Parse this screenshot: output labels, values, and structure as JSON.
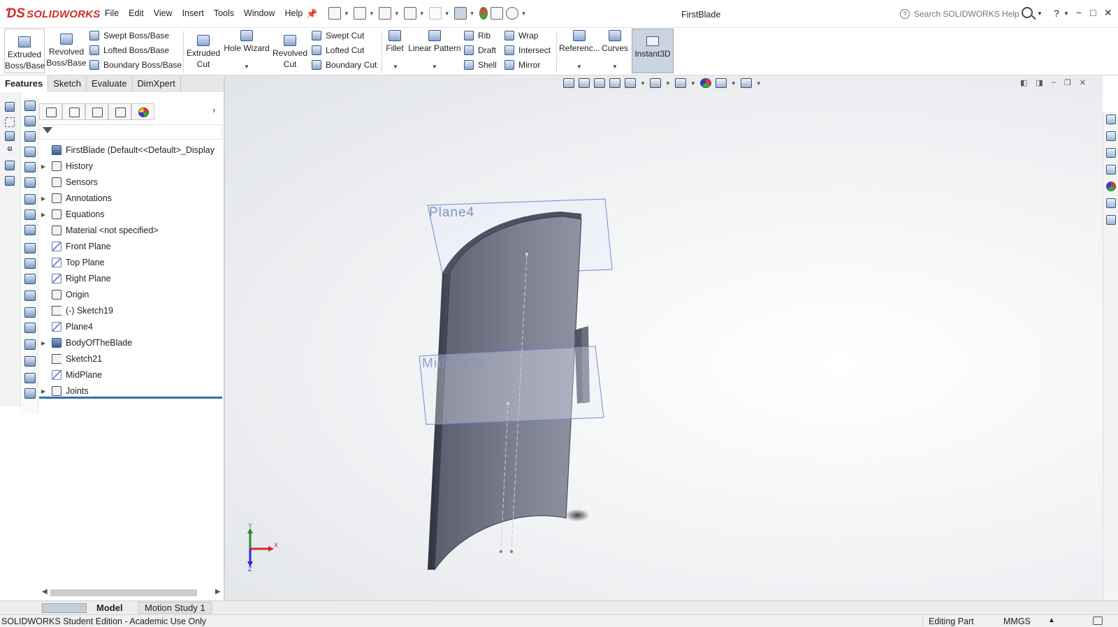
{
  "app": {
    "logo_text": "SOLIDWORKS",
    "document_title": "FirstBlade",
    "brand_color": "#d22b2b",
    "accent_color": "#2d6fb3"
  },
  "menu": {
    "items": [
      "File",
      "Edit",
      "View",
      "Insert",
      "Tools",
      "Window",
      "Help"
    ]
  },
  "search": {
    "placeholder": "Search SOLIDWORKS Help",
    "value": ""
  },
  "help_label": "?",
  "window_controls": {
    "minimize": "−",
    "maximize": "□",
    "close": "✕"
  },
  "commands": {
    "extruded_boss": "Extruded Boss/Base",
    "revolved_boss": "Revolved Boss/Base",
    "swept_boss": "Swept Boss/Base",
    "lofted_boss": "Lofted Boss/Base",
    "boundary_boss": "Boundary Boss/Base",
    "extruded_cut": "Extruded Cut",
    "hole_wizard": "Hole Wizard",
    "revolved_cut": "Revolved Cut",
    "swept_cut": "Swept Cut",
    "lofted_cut": "Lofted Cut",
    "boundary_cut": "Boundary Cut",
    "fillet": "Fillet",
    "linear_pattern": "Linear Pattern",
    "rib": "Rib",
    "draft": "Draft",
    "shell": "Shell",
    "wrap": "Wrap",
    "intersect": "Intersect",
    "mirror": "Mirror",
    "reference": "Referenc...",
    "curves": "Curves",
    "instant3d": "Instant3D"
  },
  "tabs": [
    "Features",
    "Sketch",
    "Evaluate",
    "DimXpert"
  ],
  "feature_tree": {
    "root": "FirstBlade  (Default<<Default>_Display",
    "nodes": [
      {
        "label": "History",
        "icon": "history-folder-icon",
        "expandable": true
      },
      {
        "label": "Sensors",
        "icon": "sensors-icon",
        "expandable": false
      },
      {
        "label": "Annotations",
        "icon": "annotations-icon",
        "expandable": true
      },
      {
        "label": "Equations",
        "icon": "equations-icon",
        "expandable": true
      },
      {
        "label": "Material <not specified>",
        "icon": "material-icon",
        "expandable": false
      },
      {
        "label": "Front Plane",
        "icon": "plane-icon",
        "expandable": false
      },
      {
        "label": "Top Plane",
        "icon": "plane-icon",
        "expandable": false
      },
      {
        "label": "Right Plane",
        "icon": "plane-icon",
        "expandable": false
      },
      {
        "label": "Origin",
        "icon": "origin-icon",
        "expandable": false
      },
      {
        "label": "(-) Sketch19",
        "icon": "sketch-icon",
        "expandable": false
      },
      {
        "label": "Plane4",
        "icon": "plane-icon",
        "expandable": false
      },
      {
        "label": "BodyOfTheBlade",
        "icon": "extrude-body-icon",
        "expandable": true
      },
      {
        "label": "Sketch21",
        "icon": "sketch-icon",
        "expandable": false
      },
      {
        "label": "MidPlane",
        "icon": "plane-icon",
        "expandable": false
      },
      {
        "label": "Joints",
        "icon": "joints-folder-icon",
        "expandable": true
      }
    ]
  },
  "viewport": {
    "plane_labels": [
      "Plane4",
      "MidPlane"
    ],
    "triad_labels": {
      "x": "X",
      "y": "Y",
      "z": "Z"
    }
  },
  "bottom_tabs": [
    "Model",
    "Motion Study 1"
  ],
  "status": {
    "left": "SOLIDWORKS Student Edition - Academic Use Only",
    "editing": "Editing Part",
    "units": "MMGS",
    "units_arrow": "▲"
  }
}
